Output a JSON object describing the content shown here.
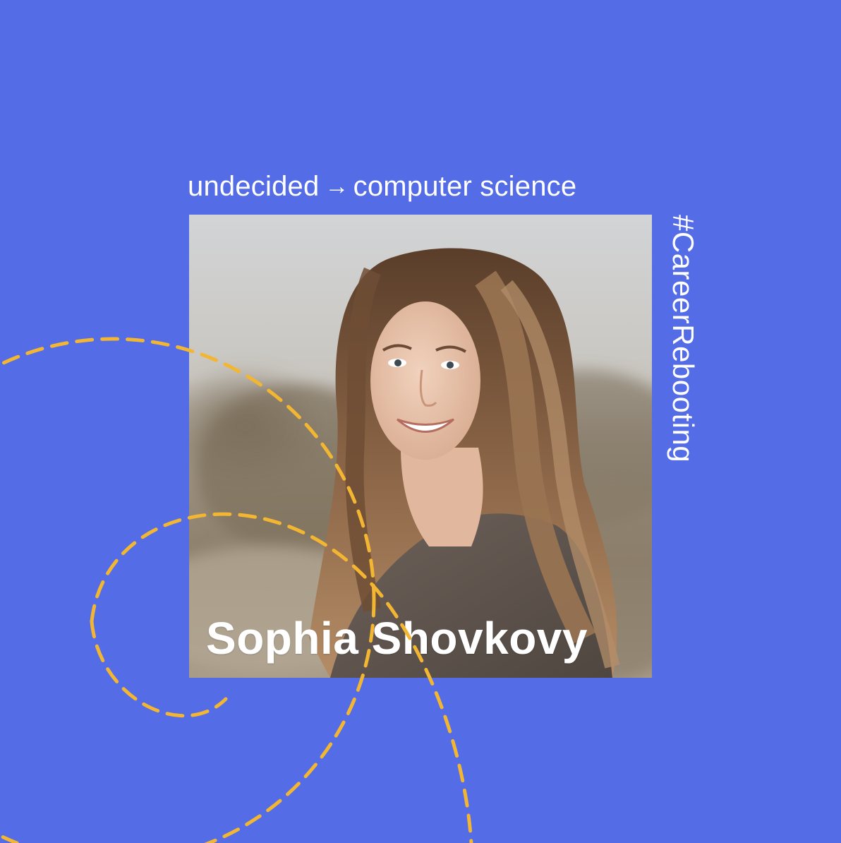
{
  "headline": {
    "from": "undecided",
    "arrow": "→",
    "to": "computer science"
  },
  "person": {
    "name": "Sophia Shovkovy"
  },
  "hashtag": "#CareerRebooting",
  "colors": {
    "background": "#546ce6",
    "accent_dash": "#f2b632",
    "text": "#ffffff"
  },
  "icons": {
    "arrow": "right-arrow-icon"
  }
}
